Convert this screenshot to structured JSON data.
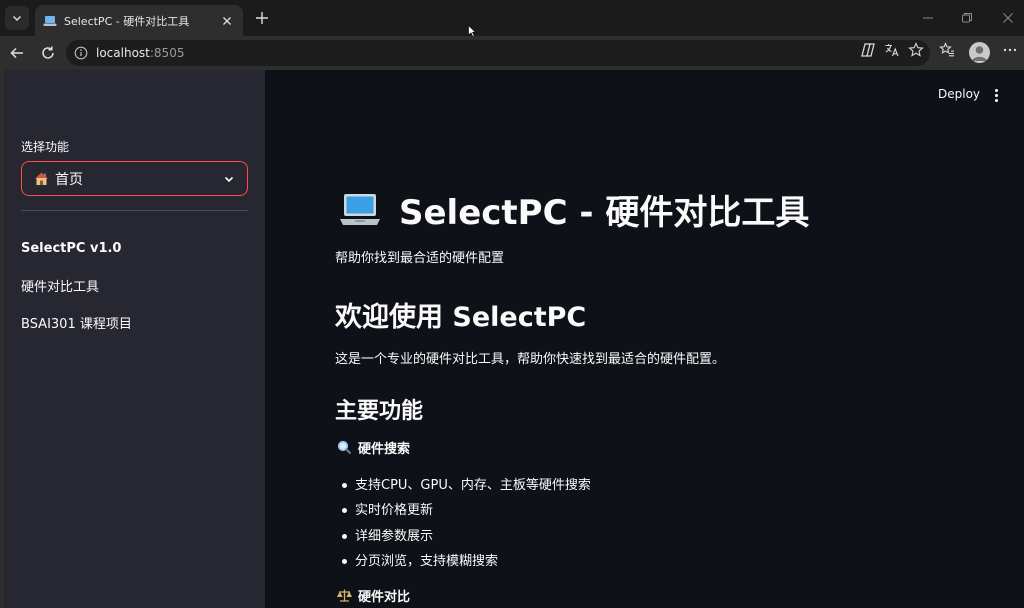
{
  "browser": {
    "tab_title": "SelectPC - 硬件对比工具",
    "url_host": "localhost",
    "url_port": ":8505"
  },
  "sidebar": {
    "select_label": "选择功能",
    "selected_option": "首页",
    "version": "SelectPC v1.0",
    "lines": [
      "硬件对比工具",
      "BSAI301 课程项目"
    ]
  },
  "header": {
    "deploy_label": "Deploy"
  },
  "main": {
    "title": "SelectPC - 硬件对比工具",
    "subtitle": "帮助你找到最合适的硬件配置",
    "welcome_heading": "欢迎使用 SelectPC",
    "intro": "这是一个专业的硬件对比工具，帮助你快速找到最适合的硬件配置。",
    "features_heading": "主要功能",
    "search_heading": "硬件搜索",
    "search_bullets": [
      "支持CPU、GPU、内存、主板等硬件搜索",
      "实时价格更新",
      "详细参数展示",
      "分页浏览，支持模糊搜索"
    ],
    "compare_heading": "硬件对比"
  },
  "icons": {
    "tab_favicon": "laptop-icon",
    "select_option": "house-icon",
    "search": "magnifier-icon",
    "compare": "scales-icon"
  },
  "colors": {
    "accent": "#ff4b4b",
    "sidebar_bg": "#262730",
    "main_bg": "#0e1117",
    "text": "#fafafa"
  }
}
